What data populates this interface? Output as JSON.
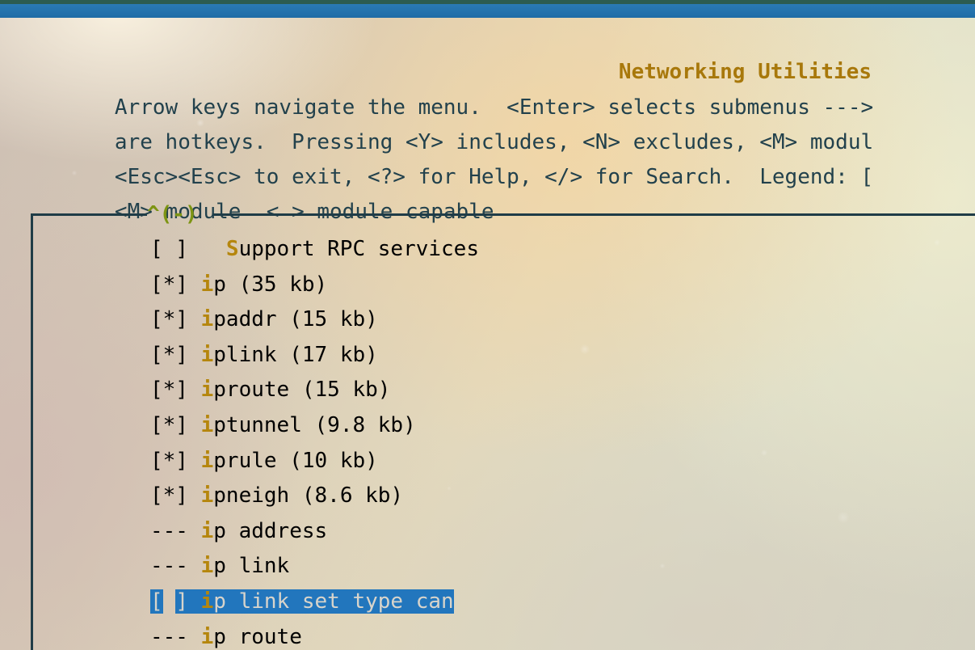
{
  "window": {
    "titlebar_accent_color": "#2c5c51",
    "titlebar_color": "#1f6ca6"
  },
  "header": {
    "title": "Networking Utilities",
    "title_color": "#a8780b",
    "help_lines": [
      "Arrow keys navigate the menu.  <Enter> selects submenus --->",
      "are hotkeys.  Pressing <Y> includes, <N> excludes, <M> modul",
      "<Esc><Esc> to exit, <?> for Help, </> for Search.  Legend: [",
      "<M> module  < > module capable"
    ]
  },
  "list_box": {
    "scroll_indicator": "^(-)",
    "scroll_indicator_color": "#7d9413",
    "border_color": "#1f3c47",
    "highlight_color": "#2276bd",
    "highlight_text_color": "#d8d4cb",
    "hotkey_color": "#b5860d",
    "items": [
      {
        "marker": "[ ]",
        "gap": "   ",
        "hotkey": "S",
        "rest": "upport RPC services",
        "selected": false
      },
      {
        "marker": "[*]",
        "gap": " ",
        "hotkey": "i",
        "rest": "p (35 kb)",
        "selected": false
      },
      {
        "marker": "[*]",
        "gap": " ",
        "hotkey": "i",
        "rest": "paddr (15 kb)",
        "selected": false
      },
      {
        "marker": "[*]",
        "gap": " ",
        "hotkey": "i",
        "rest": "plink (17 kb)",
        "selected": false
      },
      {
        "marker": "[*]",
        "gap": " ",
        "hotkey": "i",
        "rest": "proute (15 kb)",
        "selected": false
      },
      {
        "marker": "[*]",
        "gap": " ",
        "hotkey": "i",
        "rest": "ptunnel (9.8 kb)",
        "selected": false
      },
      {
        "marker": "[*]",
        "gap": " ",
        "hotkey": "i",
        "rest": "prule (10 kb)",
        "selected": false
      },
      {
        "marker": "[*]",
        "gap": " ",
        "hotkey": "i",
        "rest": "pneigh (8.6 kb)",
        "selected": false
      },
      {
        "marker": "---",
        "gap": " ",
        "hotkey": "i",
        "rest": "p address",
        "selected": false
      },
      {
        "marker": "---",
        "gap": " ",
        "hotkey": "i",
        "rest": "p link",
        "selected": false
      },
      {
        "marker": "[ ]",
        "gap": " ",
        "hotkey": "i",
        "rest": "p link set type can",
        "selected": true
      },
      {
        "marker": "---",
        "gap": " ",
        "hotkey": "i",
        "rest": "p route",
        "selected": false
      }
    ]
  }
}
